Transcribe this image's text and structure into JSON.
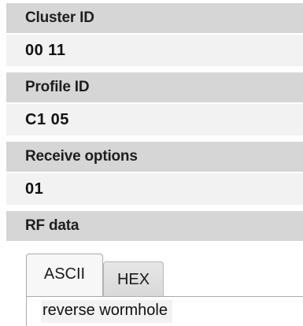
{
  "fields": {
    "cluster_id": {
      "label": "Cluster ID",
      "value": "00 11"
    },
    "profile_id": {
      "label": "Profile ID",
      "value": "C1 05"
    },
    "receive_options": {
      "label": "Receive options",
      "value": "01"
    },
    "rf_data": {
      "label": "RF data",
      "tabs": [
        {
          "label": "ASCII",
          "active": true
        },
        {
          "label": "HEX",
          "active": false
        }
      ],
      "ascii_value": "reverse wormhole"
    }
  }
}
